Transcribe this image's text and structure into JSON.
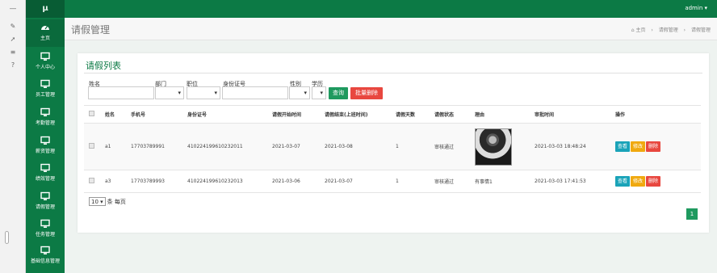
{
  "toolstrip": {
    "icons": [
      "pencil-icon",
      "cursor-icon",
      "sliders-icon",
      "help-icon"
    ]
  },
  "sidebar": {
    "logo": "μ",
    "items": [
      {
        "label": "主页",
        "icon": "dashboard-icon"
      },
      {
        "label": "个人中心",
        "icon": "monitor-icon"
      },
      {
        "label": "员工管理",
        "icon": "monitor-icon"
      },
      {
        "label": "考勤管理",
        "icon": "monitor-icon"
      },
      {
        "label": "薪资管理",
        "icon": "monitor-icon"
      },
      {
        "label": "绩效管理",
        "icon": "monitor-icon"
      },
      {
        "label": "请假管理",
        "icon": "monitor-icon"
      },
      {
        "label": "任务管理",
        "icon": "monitor-icon"
      },
      {
        "label": "基础信息管理",
        "icon": "monitor-icon"
      }
    ]
  },
  "header": {
    "user": "admin ▾"
  },
  "titlebar": {
    "title": "请假管理",
    "breadcrumb": [
      "主页",
      "请假管理",
      "请假管理"
    ]
  },
  "panel": {
    "title": "请假列表"
  },
  "filters": {
    "name_label": "姓名",
    "dept_label": "部门",
    "position_label": "职位",
    "id_label": "身份证号",
    "gender_label": "性别",
    "edu_label": "学历",
    "search_button": "查询",
    "batch_delete_button": "批量删除"
  },
  "table": {
    "headers": [
      "",
      "姓名",
      "手机号",
      "身份证号",
      "请假开始时间",
      "请假结束(上班时间)",
      "请假天数",
      "请假状态",
      "理由",
      "审批时间",
      "操作"
    ],
    "rows": [
      {
        "name": "a1",
        "phone": "17703789991",
        "id": "410224199610232011",
        "start": "2021-03-07",
        "end": "2021-03-08",
        "days": "1",
        "status": "审核通过",
        "reason": "",
        "approved": "2021-03-03 18:48:24"
      },
      {
        "name": "a3",
        "phone": "17703789993",
        "id": "410224199610232013",
        "start": "2021-03-06",
        "end": "2021-03-07",
        "days": "1",
        "status": "审核通过",
        "reason": "有事情1",
        "approved": "2021-03-03 17:41:53"
      }
    ],
    "actions": {
      "view": "查看",
      "edit": "修改",
      "delete": "删除"
    }
  },
  "pagination": {
    "page_size": "10",
    "page_size_suffix": "条 每页",
    "current_page": "1"
  },
  "colors": {
    "brand": "#0c7a45",
    "success": "#1f9a5f",
    "danger": "#e8473f",
    "info": "#1aa3b8",
    "warning": "#f0a90f"
  }
}
